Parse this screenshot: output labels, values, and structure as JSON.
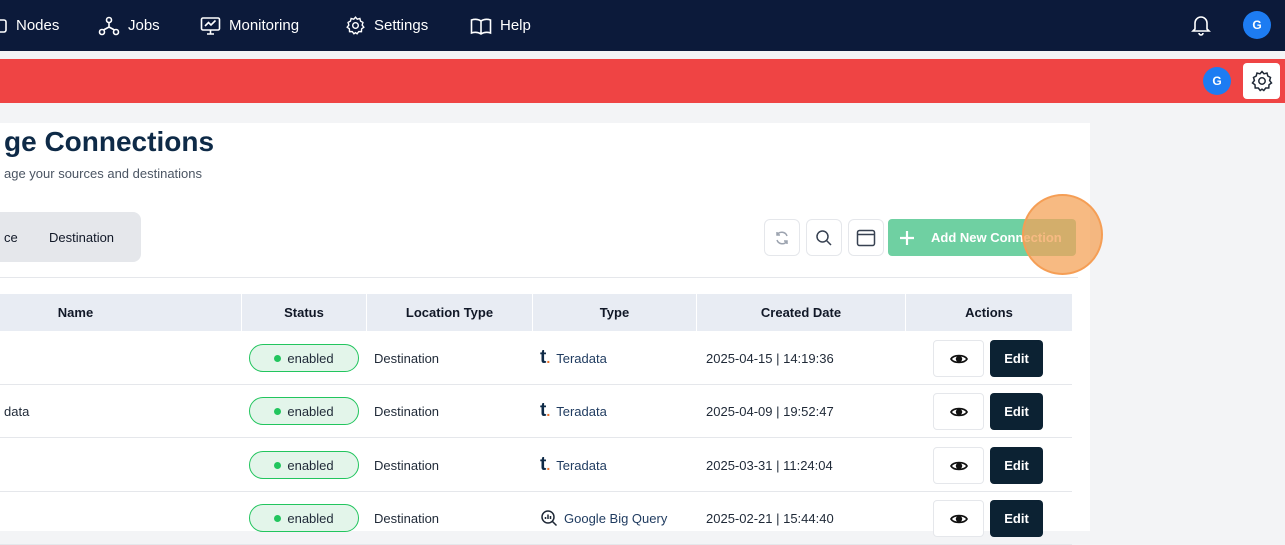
{
  "nav": {
    "items": [
      {
        "label": "Nodes",
        "icon": "nodes-icon"
      },
      {
        "label": "Jobs",
        "icon": "jobs-icon"
      },
      {
        "label": "Monitoring",
        "icon": "monitoring-icon"
      },
      {
        "label": "Settings",
        "icon": "gear-icon"
      },
      {
        "label": "Help",
        "icon": "book-icon"
      }
    ],
    "avatar_initial": "G"
  },
  "subbar": {
    "avatar_initial": "G"
  },
  "page": {
    "title": "ge Connections",
    "subtitle": "age your sources and destinations"
  },
  "tabs": [
    {
      "label": "ce"
    },
    {
      "label": "Destination"
    }
  ],
  "toolbar": {
    "add_label": "Add New Connection"
  },
  "table": {
    "columns": [
      "Name",
      "Status",
      "Location Type",
      "Type",
      "Created Date",
      "Actions"
    ],
    "rows": [
      {
        "name": "",
        "status": "enabled",
        "location_type": "Destination",
        "type": "Teradata",
        "type_icon": "teradata-icon",
        "created": "2025-04-15 | 14:19:36",
        "edit": "Edit"
      },
      {
        "name": "data",
        "status": "enabled",
        "location_type": "Destination",
        "type": "Teradata",
        "type_icon": "teradata-icon",
        "created": "2025-04-09 | 19:52:47",
        "edit": "Edit"
      },
      {
        "name": "",
        "status": "enabled",
        "location_type": "Destination",
        "type": "Teradata",
        "type_icon": "teradata-icon",
        "created": "2025-03-31 | 11:24:04",
        "edit": "Edit"
      },
      {
        "name": "",
        "status": "enabled",
        "location_type": "Destination",
        "type": "Google Big Query",
        "type_icon": "bigquery-icon",
        "created": "2025-02-21 | 15:44:40",
        "edit": "Edit"
      }
    ]
  },
  "colors": {
    "topbar": "#0c1a3a",
    "banner": "#ef4444",
    "accent": "#6fd0a2",
    "edit": "#0c2233"
  }
}
